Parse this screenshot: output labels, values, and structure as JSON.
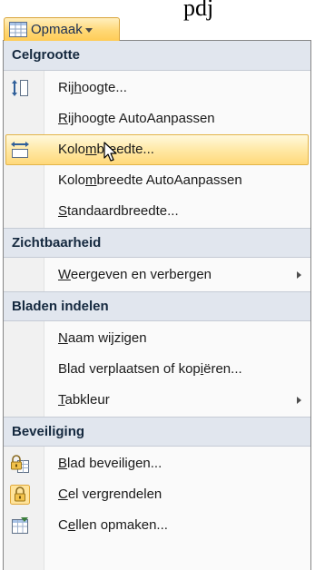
{
  "page_text": "pdj",
  "ribbon_button": {
    "label": "Opmaak",
    "icon": "format-cells-icon"
  },
  "menu": {
    "sections": [
      {
        "header": "Celgrootte",
        "items": [
          {
            "pre": "Rij",
            "ul": "h",
            "post": "oogte...",
            "icon": "row-height-icon",
            "submenu": false
          },
          {
            "pre": "",
            "ul": "R",
            "post": "ijhoogte AutoAanpassen",
            "icon": "",
            "submenu": false
          },
          {
            "pre": "Kolo",
            "ul": "m",
            "post": "breedte...",
            "icon": "column-width-icon",
            "submenu": false,
            "highlighted": true
          },
          {
            "pre": "Kolo",
            "ul": "m",
            "post": "breedte AutoAanpassen",
            "icon": "",
            "submenu": false
          },
          {
            "pre": "",
            "ul": "S",
            "post": "tandaardbreedte...",
            "icon": "",
            "submenu": false
          }
        ]
      },
      {
        "header": "Zichtbaarheid",
        "items": [
          {
            "pre": "",
            "ul": "W",
            "post": "eergeven en verbergen",
            "icon": "",
            "submenu": true
          }
        ]
      },
      {
        "header": "Bladen indelen",
        "items": [
          {
            "pre": "",
            "ul": "N",
            "post": "aam wijzigen",
            "icon": "",
            "submenu": false
          },
          {
            "pre": "Blad verplaatsen of kop",
            "ul": "i",
            "post": "ëren...",
            "icon": "",
            "submenu": false
          },
          {
            "pre": "",
            "ul": "T",
            "post": "abkleur",
            "icon": "",
            "submenu": true
          }
        ]
      },
      {
        "header": "Beveiliging",
        "items": [
          {
            "pre": "",
            "ul": "B",
            "post": "lad beveiligen...",
            "icon": "protect-sheet-icon",
            "submenu": false
          },
          {
            "pre": "",
            "ul": "C",
            "post": "el vergrendelen",
            "icon": "lock-cell-icon",
            "submenu": false
          },
          {
            "pre": "C",
            "ul": "e",
            "post": "llen opmaken...",
            "icon": "format-cells-icon",
            "submenu": false
          }
        ]
      }
    ]
  },
  "colors": {
    "highlight": "#ffe9a6",
    "header_bg": "#e1e6ee",
    "gutter_bg": "#f1f1f1"
  }
}
